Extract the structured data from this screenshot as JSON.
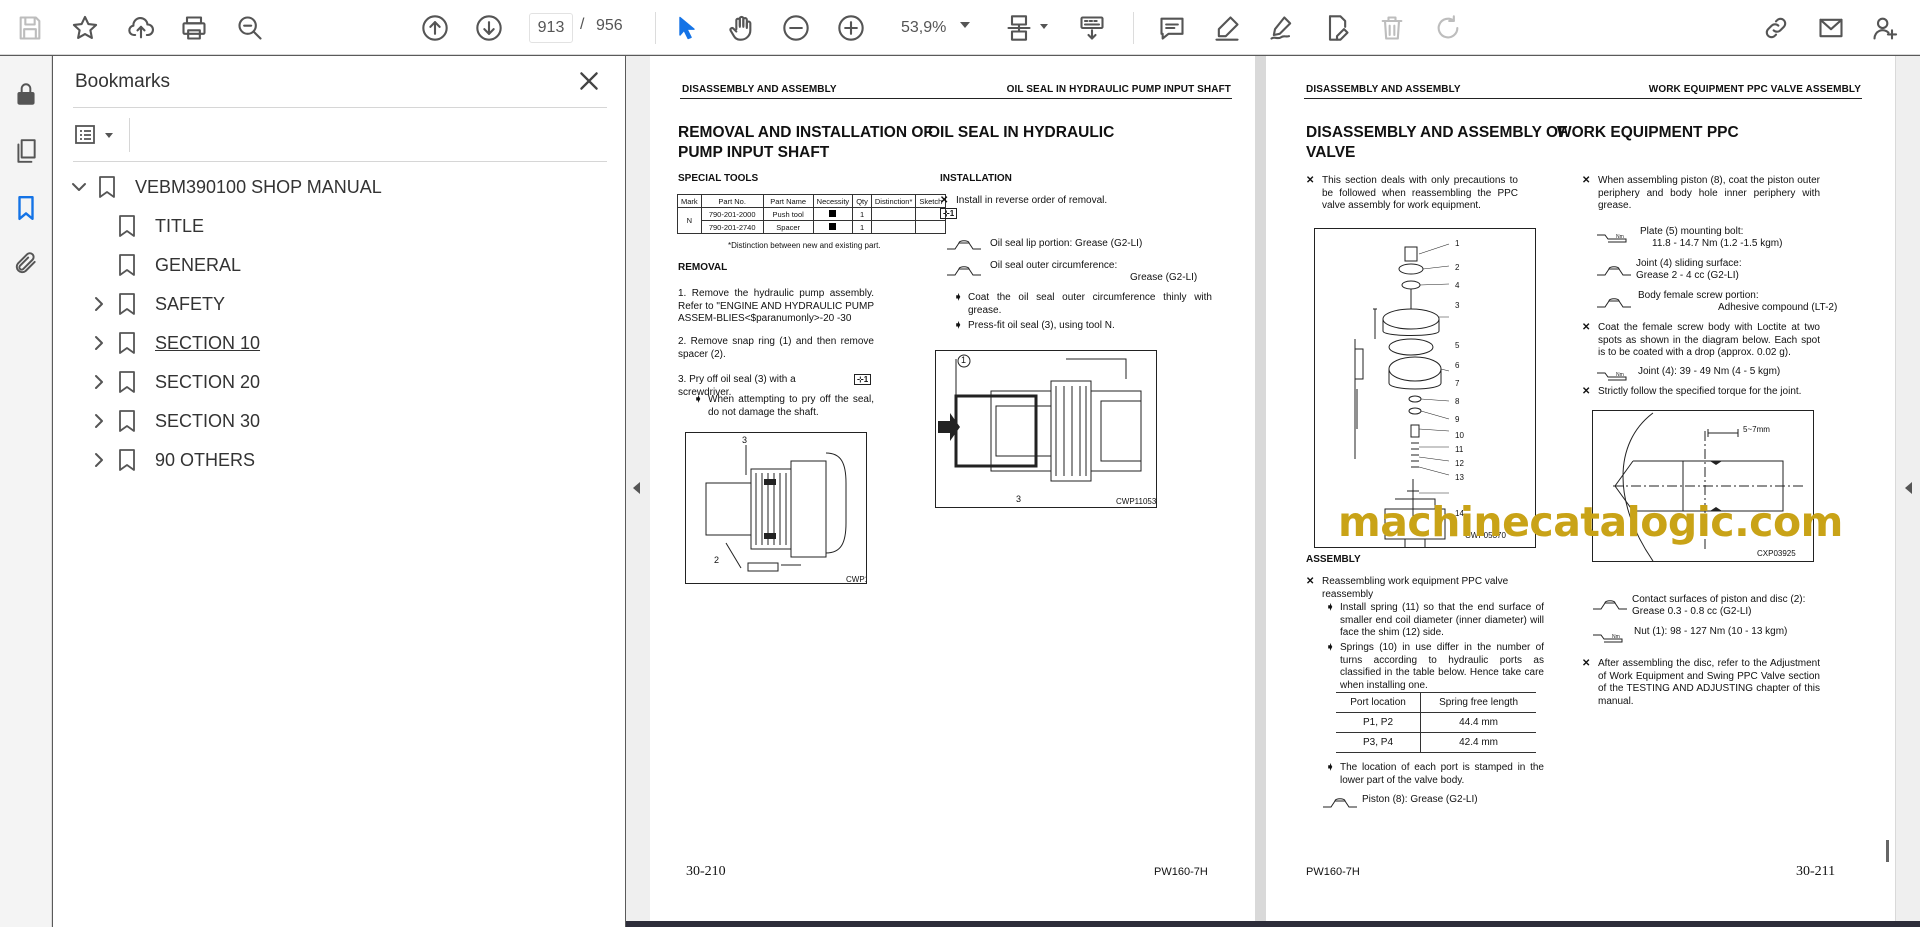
{
  "toolbar": {
    "page_current": "913",
    "page_separator": "/",
    "page_total": "956",
    "zoom": "53,9%"
  },
  "bookmarks": {
    "title": "Bookmarks",
    "items": [
      {
        "label": "VEBM390100 SHOP MANUAL",
        "level": 0,
        "expanded": true
      },
      {
        "label": "TITLE",
        "level": 1
      },
      {
        "label": "GENERAL",
        "level": 1
      },
      {
        "label": "SAFETY",
        "level": 1,
        "expandable": true
      },
      {
        "label": "SECTION 10",
        "level": 1,
        "expandable": true
      },
      {
        "label": "SECTION 20",
        "level": 1,
        "expandable": true
      },
      {
        "label": "SECTION 30",
        "level": 1,
        "expandable": true
      },
      {
        "label": "90 OTHERS",
        "level": 1,
        "expandable": true
      }
    ]
  },
  "watermark": "machinecatalogic.com",
  "page_left": {
    "header_left": "DISASSEMBLY AND ASSEMBLY",
    "header_right": "OIL SEAL IN HYDRAULIC PUMP INPUT SHAFT",
    "title_line1": "REMOVAL AND INSTALLATION OF",
    "title_line1b": "OIL SEAL IN HYDRAULIC",
    "title_line2": "PUMP INPUT SHAFT",
    "special_tools": "SPECIAL TOOLS",
    "tools_table": {
      "headers": [
        "Mark",
        "Part No.",
        "Part Name",
        "Necessity",
        "Qty",
        "Distinction*",
        "Sketch"
      ],
      "mark": "N",
      "rows": [
        {
          "part_no": "790-201-2000",
          "name": "Push tool",
          "qty": "1"
        },
        {
          "part_no": "790-201-2740",
          "name": "Spacer",
          "qty": "1"
        }
      ],
      "note": "*Distinction between new and existing part."
    },
    "removal_heading": "REMOVAL",
    "removal_1": "1.   Remove the hydraulic pump assembly. Refer to \"ENGINE AND HYDRAULIC PUMP ASSEM-BLIES<$paranumonly>-20 -30",
    "removal_2": "2.   Remove snap ring (1) and then remove spacer (2).",
    "removal_3": "3.   Pry off oil seal (3) with a screwdriver.",
    "removal_3_note": "When attempting to pry off the seal, do not damage the shaft.",
    "fig1_code": "CWP11052",
    "fig1_labels": [
      "3",
      "2"
    ],
    "installation_heading": "INSTALLATION",
    "install_1": "Install in reverse order of removal.",
    "install_lip": "Oil seal lip portion: Grease (G2-LI)",
    "install_outer": "Oil seal outer circumference:",
    "install_outer_val": "Grease (G2-LI)",
    "install_coat": "Coat the oil seal outer circumference thinly with grease.",
    "install_press": "Press-fit oil seal (3), using tool N.",
    "fig2_code": "CWP11053",
    "fig2_labels": [
      "1",
      "3"
    ],
    "footer_page": "30-210",
    "footer_model": "PW160-7H"
  },
  "page_right": {
    "header_left": "DISASSEMBLY AND ASSEMBLY",
    "header_right": "WORK EQUIPMENT PPC VALVE ASSEMBLY",
    "title_line1": "DISASSEMBLY AND ASSEMBLY OF",
    "title_line1b": "WORK EQUIPMENT PPC",
    "title_line2": "VALVE",
    "intro": "This section deals with only precautions to be followed when reassembling the PPC valve assembly for work equipment.",
    "fig3_code": "CWP05370",
    "fig3_labels": [
      "1",
      "2",
      "4",
      "3",
      "5",
      "6",
      "7",
      "8",
      "9",
      "10",
      "11",
      "12",
      "13",
      "14"
    ],
    "assembly_heading": "ASSEMBLY",
    "asm_1": "Reassembling work equipment PPC valve reassembly",
    "asm_spring": "Install spring (11) so that the end surface of smaller end coil diameter (inner diameter) will face the shim (12) side.",
    "asm_springs": "Springs (10) in use differ in the number of turns according to hydraulic ports as classified in the table below. Hence take care when installing one.",
    "spring_table": {
      "headers": [
        "Port location",
        "Spring free length"
      ],
      "rows": [
        [
          "P1, P2",
          "44.4 mm"
        ],
        [
          "P3, P4",
          "42.4 mm"
        ]
      ]
    },
    "asm_location": "The location of each port is stamped in the lower part of the valve body.",
    "asm_piston": "Piston (8):  Grease (G2-LI)",
    "col2_piston": "When assembling piston (8), coat the piston outer periphery and body hole inner periphery with grease.",
    "col2_plate": "Plate (5) mounting bolt:",
    "col2_plate_val": "11.8 - 14.7 Nm (1.2 -1.5 kgm)",
    "col2_joint_sliding": "Joint (4) sliding surface:",
    "col2_joint_sliding_val": "Grease 2 - 4 cc (G2-LI)",
    "col2_body": "Body female screw portion:",
    "col2_body_val": "Adhesive compound (LT-2)",
    "col2_coat": "Coat the female screw body with Loctite at two spots as shown in the diagram below. Each spot is to be coated with a drop (approx. 0.02 g).",
    "col2_joint": "Joint (4):    39 - 49 Nm (4 - 5 kgm)",
    "col2_torque": "Strictly follow the specified torque for the joint.",
    "fig4_code": "CXP03925",
    "fig4_dim": "5~7mm",
    "col2_contact": "Contact surfaces of piston and disc (2):",
    "col2_contact_val": "Grease 0.3 - 0.8 cc (G2-LI)",
    "col2_nut": "Nut (1):   98 - 127 Nm (10 - 13 kgm)",
    "col2_after": "After assembling the disc, refer to the Adjustment of Work Equipment and Swing PPC Valve section of the TESTING AND ADJUSTING chapter of this manual.",
    "footer_model": "PW160-7H",
    "footer_page": "30-211"
  }
}
